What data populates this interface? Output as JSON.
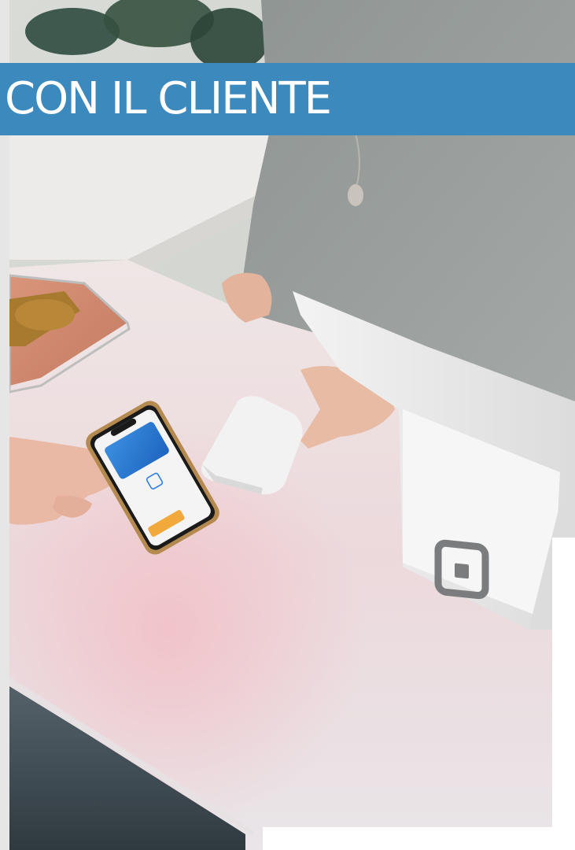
{
  "banner": {
    "title": "CON IL CLIENTE",
    "background_color": "#3c89bd",
    "text_color": "#ffffff"
  },
  "photo": {
    "subject": "contactless-phone-payment",
    "icons": [
      "square-logo-icon",
      "face-id-icon"
    ]
  }
}
